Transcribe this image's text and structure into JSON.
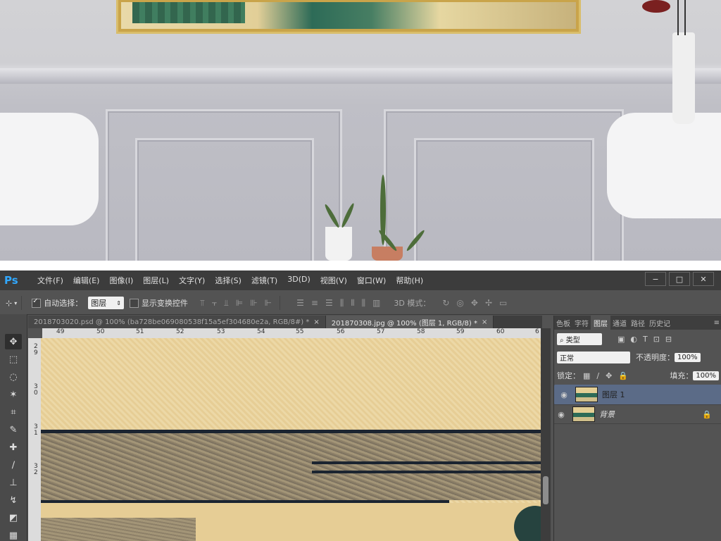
{
  "colors": {
    "ps_accent": "#31a8ff",
    "ps_bg": "#535353",
    "menubar_bg": "#3c3c3c",
    "layer_selected": "#5b6b87"
  },
  "app": {
    "logo": "Ps"
  },
  "menu": [
    "文件(F)",
    "编辑(E)",
    "图像(I)",
    "图层(L)",
    "文字(Y)",
    "选择(S)",
    "滤镜(T)",
    "3D(D)",
    "视图(V)",
    "窗口(W)",
    "帮助(H)"
  ],
  "window_buttons": {
    "minimize": "−",
    "maximize": "□",
    "close": "✕"
  },
  "options": {
    "auto_select_label": "自动选择：",
    "auto_select_value": "图层",
    "transform_controls_label": "显示变换控件",
    "mode_3d_label": "3D 模式："
  },
  "tabs": [
    {
      "label": "2018703020.psd @ 100% (ba728be069080538f15a5ef304680e2a, RGB/8#) *",
      "close": "×"
    },
    {
      "label": "201870308.jpg @ 100% (图层 1, RGB/8) *",
      "close": "×"
    }
  ],
  "ruler_h": [
    "49",
    "50",
    "51",
    "52",
    "53",
    "54",
    "55",
    "56",
    "57",
    "58",
    "59",
    "60",
    "6"
  ],
  "ruler_v": [
    [
      "2",
      "9"
    ],
    [
      "3",
      "0"
    ],
    [
      "3",
      "1"
    ],
    [
      "3",
      "2"
    ]
  ],
  "panel": {
    "tabs": [
      "色板",
      "字符",
      "图层",
      "通道",
      "路径",
      "历史记"
    ],
    "kind_filter": "类型",
    "blend_mode": "正常",
    "opacity_label": "不透明度：",
    "opacity_value": "100%",
    "lock_label": "锁定：",
    "fill_label": "填充：",
    "fill_value": "100%",
    "layers": [
      {
        "name": "图层 1"
      },
      {
        "name": "背景"
      }
    ]
  }
}
